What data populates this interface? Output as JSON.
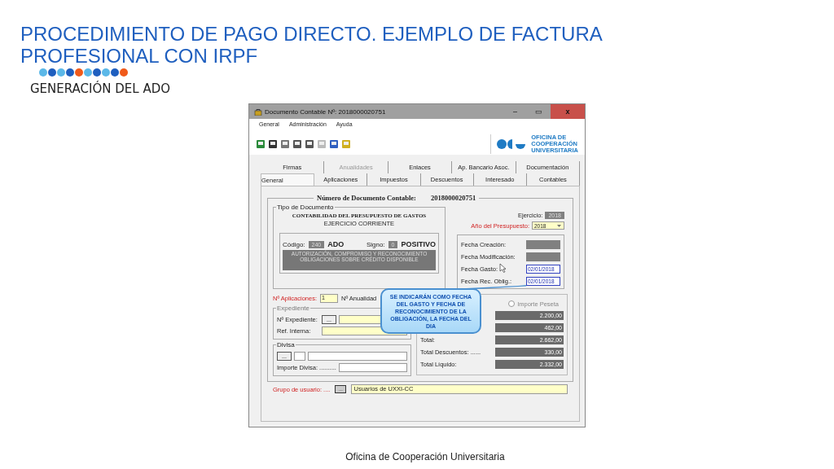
{
  "slide": {
    "title": "PROCEDIMIENTO DE PAGO DIRECTO. EJEMPLO DE FACTURA PROFESIONAL CON IRPF",
    "subtitle": "GENERACIÓN DEL ADO",
    "footer": "Oficina de Cooperación Universitaria"
  },
  "window": {
    "title": "Documento Contable Nº: 2018000020751",
    "minimize": "–",
    "maximize": "▭",
    "close": "x"
  },
  "menu": [
    "General",
    "Administración",
    "Ayuda"
  ],
  "logo": {
    "lines": [
      "OFICINA DE",
      "COOPERACIÓN",
      "UNIVERSITARIA"
    ]
  },
  "tabs_row_1": [
    {
      "label": "Firmas",
      "selected": false,
      "disabled": false
    },
    {
      "label": "Anualidades",
      "selected": false,
      "disabled": true
    },
    {
      "label": "Enlaces",
      "selected": false,
      "disabled": false
    },
    {
      "label": "Ap. Bancario Asoc.",
      "selected": false,
      "disabled": false
    },
    {
      "label": "Documentación",
      "selected": false,
      "disabled": false
    }
  ],
  "tabs_row_2": [
    {
      "label": "General",
      "selected": true,
      "disabled": false
    },
    {
      "label": "Aplicaciones",
      "selected": false,
      "disabled": false
    },
    {
      "label": "Impuestos",
      "selected": false,
      "disabled": false
    },
    {
      "label": "Descuentos",
      "selected": false,
      "disabled": false
    },
    {
      "label": "Interesado",
      "selected": false,
      "disabled": false
    },
    {
      "label": "Contables",
      "selected": false,
      "disabled": false
    }
  ],
  "document": {
    "label": "Número de Documento Contable:",
    "number": "2018000020751"
  },
  "tipo": {
    "legend": "Tipo de Documento",
    "line_1": "CONTABILIDAD DEL PRESUPUESTO DE GASTOS",
    "line_2": "EJERCICIO CORRIENTE",
    "codigo_label": "Código:",
    "codigo": "240",
    "codigo_name": "ADO",
    "signo_label": "Signo:",
    "signo": "0",
    "signo_name": "POSITIVO",
    "description": "AUTORIZACIÓN, COMPROMISO Y RECONOCIMIENTO OBLIGACIONES SOBRE CRÉDITO DISPONIBLE"
  },
  "ejercicio": {
    "label": "Ejercicio:",
    "value": "2018"
  },
  "presupuesto": {
    "label": "Año del Presupuesto:",
    "value": "2018"
  },
  "dates": [
    {
      "label": "Fecha Creación:"
    },
    {
      "label": "Fecha Modificación:"
    },
    {
      "label": "Fecha Gasto:",
      "value": "02/01/2018"
    },
    {
      "label": "Fecha Rec. Oblig.:",
      "value": "02/01/2018"
    }
  ],
  "aplicaciones": {
    "label": "Nº Aplicaciones:",
    "value": "1",
    "anualidad_label": "Nº Anualidad"
  },
  "expediente": {
    "legend": "Expediente",
    "fields": [
      {
        "label": "Nº Expediente:",
        "button": "..."
      },
      {
        "label": "Ref. Interna:"
      }
    ]
  },
  "divisa": {
    "legend": "Divisa",
    "button": "...",
    "importe_label": "Importe Divisa: .........."
  },
  "amounts": {
    "radio": {
      "label": "Importe Peseta",
      "selected": false
    },
    "rows": [
      {
        "value": "2.200,00"
      },
      {
        "value": "462,00"
      },
      {
        "label": "Total:",
        "value": "2.662,00"
      },
      {
        "label": "Total Descuentos: ......",
        "value": "330,00"
      },
      {
        "label": "Total Líquido:",
        "value": "2.332,00"
      }
    ]
  },
  "grupo": {
    "label": "Grupo de usuario: ....",
    "button": "...",
    "value": "Usuarios de UXXI-CC"
  },
  "callout": {
    "text": "SE INDICARÁN COMO FECHA DEL GASTO Y FECHA DE RECONOCIMIENTO DE LA OBLIGACIÓN, LA FECHA DEL DIA"
  }
}
